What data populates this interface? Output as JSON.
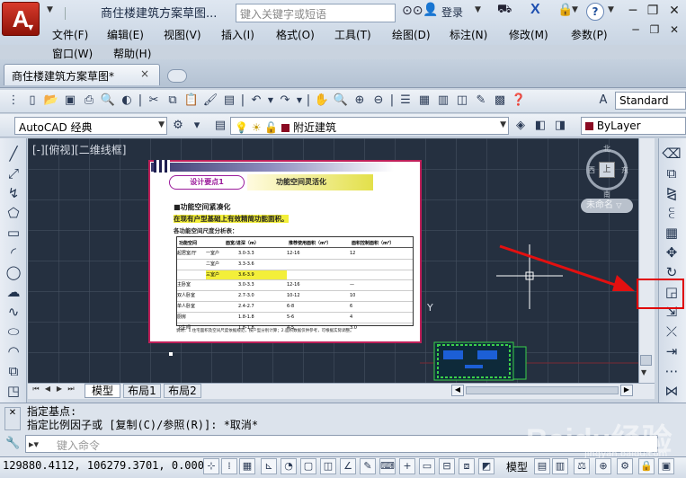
{
  "titlebar": {
    "app_logo": "A",
    "doc_title": "商住楼建筑方案草图...",
    "search_placeholder": "键入关键字或短语",
    "login": "登录",
    "help": "?"
  },
  "menu": {
    "items": [
      "文件(F)",
      "编辑(E)",
      "视图(V)",
      "插入(I)",
      "格式(O)",
      "工具(T)",
      "绘图(D)",
      "标注(N)",
      "修改(M)",
      "参数(P)"
    ],
    "items_row2": [
      "窗口(W)",
      "帮助(H)"
    ]
  },
  "tabs": {
    "file_tab": "商住楼建筑方案草图*",
    "close": "×"
  },
  "toolbar1": {
    "text_style": "Standard"
  },
  "toolbar2": {
    "workspace": "AutoCAD 经典",
    "layer": "附近建筑",
    "color": "ByLayer"
  },
  "canvas": {
    "view_label": "[-][俯视][二维线框]",
    "viewcube": {
      "north": "北",
      "south": "南",
      "west": "西",
      "east": "东",
      "top": "上"
    },
    "named_view": "未命名"
  },
  "paper": {
    "tag": "设计要点1",
    "heading": "功能空间灵活化",
    "section_title": "■功能空间紧凑化",
    "highlight_line": "在现有户型基础上有效精简功能面积。",
    "subtitle": "各功能空间尺度分析表：",
    "table_header": [
      "功能空间",
      "面宽/进深（m）",
      "推荐使用面积（m²）",
      "面积控制面积（m²）"
    ],
    "table_rows": [
      [
        "起居室/厅",
        "一室户",
        "3.0-3.3",
        "12-16",
        "12"
      ],
      [
        "",
        "二室户",
        "3.3-3.6",
        "",
        ""
      ],
      [
        "",
        "三室户",
        "3.6-3.9",
        "",
        ""
      ],
      [
        "主卧室",
        "",
        "3.0-3.3",
        "12-16",
        "—"
      ],
      [
        "双人卧室",
        "",
        "2.7-3.0",
        "10-12",
        "10"
      ],
      [
        "单人卧室",
        "",
        "2.4-2.7",
        "6-8",
        "6"
      ],
      [
        "厨房",
        "",
        "1.8-1.8",
        "5-6",
        "4"
      ],
      [
        "卫生间",
        "",
        "1.8-1.8",
        "4-5",
        "3.0"
      ]
    ],
    "notes": "说明：1.住宅面积及空间尺度依据规范，按户型分别计算；2.面积数据仅供参考，可根据实际调整。"
  },
  "layout_tabs": {
    "model": "模型",
    "layout1": "布局1",
    "layout2": "布局2"
  },
  "command": {
    "line1": "指定基点:",
    "line2": "指定比例因子或 [复制(C)/参照(R)]: *取消*",
    "input_placeholder": "键入命令"
  },
  "status": {
    "coords": "129880.4112,  106279.3701,  0.0000",
    "model_label": "模型"
  },
  "watermark": {
    "text": "Baidu经验",
    "sub": "jingyan.baidu.com"
  },
  "colors": {
    "canvas_bg": "#253040",
    "highlight": "#e00000",
    "paper_border": "#c0205a"
  }
}
